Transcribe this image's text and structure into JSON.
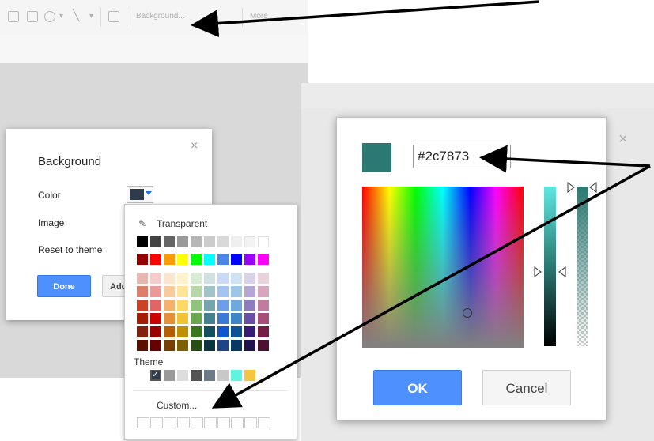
{
  "toolbar": {
    "background_label": "Background...",
    "more_label": "More",
    "icons": [
      "text-box-icon",
      "image-icon",
      "shape-icon",
      "line-icon",
      "comment-icon"
    ]
  },
  "background_dialog": {
    "title": "Background",
    "close": "×",
    "color_label": "Color",
    "image_label": "Image",
    "reset_label": "Reset to theme",
    "done_label": "Done",
    "add_label": "Add",
    "current_color": "#2e3b4a"
  },
  "palette": {
    "transparent_label": "Transparent",
    "theme_label": "Theme",
    "custom_label": "Custom...",
    "grays": [
      "#000000",
      "#434343",
      "#666666",
      "#999999",
      "#b7b7b7",
      "#cccccc",
      "#d9d9d9",
      "#efefef",
      "#f3f3f3",
      "#ffffff"
    ],
    "brights": [
      "#980000",
      "#ff0000",
      "#ff9900",
      "#ffff00",
      "#00ff00",
      "#00ffff",
      "#4a86e8",
      "#0000ff",
      "#9900ff",
      "#ff00ff"
    ],
    "shades": [
      [
        "#e6b8af",
        "#f4cccc",
        "#fce5cd",
        "#fff2cc",
        "#d9ead3",
        "#d0e0e3",
        "#c9daf8",
        "#cfe2f3",
        "#d9d2e9",
        "#ead1dc"
      ],
      [
        "#dd7e6b",
        "#ea9999",
        "#f9cb9c",
        "#ffe599",
        "#b6d7a8",
        "#a2c4c9",
        "#a4c2f4",
        "#9fc5e8",
        "#b4a7d6",
        "#d5a6bd"
      ],
      [
        "#cc4125",
        "#e06666",
        "#f6b26b",
        "#ffd966",
        "#93c47d",
        "#76a5af",
        "#6d9eeb",
        "#6fa8dc",
        "#8e7cc3",
        "#c27ba0"
      ],
      [
        "#a61c00",
        "#cc0000",
        "#e69138",
        "#f1c232",
        "#6aa84f",
        "#45818e",
        "#3c78d8",
        "#3d85c6",
        "#674ea7",
        "#a64d79"
      ],
      [
        "#85200c",
        "#990000",
        "#b45f06",
        "#bf9000",
        "#38761d",
        "#134f5c",
        "#1155cc",
        "#0b5394",
        "#351c75",
        "#741b47"
      ],
      [
        "#5b0f00",
        "#660000",
        "#783f04",
        "#7f6000",
        "#274e13",
        "#0c343d",
        "#1c4587",
        "#073763",
        "#20124d",
        "#4c1130"
      ]
    ],
    "theme_colors": [
      "#2e3b4a",
      "#999999",
      "#dddddd",
      "#555555",
      "#6c7b89",
      "#c8c8c8",
      "#5ff3e0",
      "#f5c542"
    ]
  },
  "picker": {
    "hex_value": "#2c7873",
    "preview_color": "#2c7873",
    "ok_label": "OK",
    "cancel_label": "Cancel",
    "close": "×"
  }
}
